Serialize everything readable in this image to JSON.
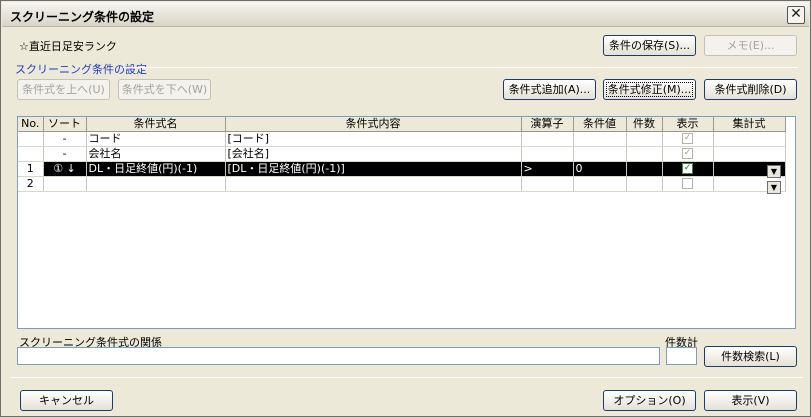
{
  "window": {
    "title": "スクリーニング条件の設定",
    "close_glyph": "✕"
  },
  "header": {
    "condition_name": "☆直近日足安ランク",
    "save_button": "条件の保存(S)...",
    "memo_button": "メモ(E)..."
  },
  "section_label": "スクリーニング条件の設定",
  "toolbar": {
    "move_up": "条件式を上へ(U)",
    "move_down": "条件式を下へ(W)",
    "add": "条件式追加(A)...",
    "modify": "条件式修正(M)...",
    "delete": "条件式削除(D)"
  },
  "grid": {
    "columns": [
      "No.",
      "ソート",
      "条件式名",
      "条件式内容",
      "演算子",
      "条件値",
      "件数",
      "表示",
      "集計式"
    ],
    "rows": [
      {
        "no": "",
        "sort": "-",
        "name": "コード",
        "content": "[コード]",
        "op": "",
        "value": "",
        "count": "",
        "show": "✓",
        "agg": ""
      },
      {
        "no": "",
        "sort": "-",
        "name": "会社名",
        "content": "[会社名]",
        "op": "",
        "value": "",
        "count": "",
        "show": "✓",
        "agg": ""
      },
      {
        "no": "1",
        "sort": "① ↓",
        "name": "DL・日足終値(円)(-1)",
        "content": "[DL・日足終値(円)(-1)]",
        "op": ">",
        "value": "0",
        "count": "",
        "show": "✓",
        "agg": ""
      },
      {
        "no": "2",
        "sort": "",
        "name": "",
        "content": "",
        "op": "",
        "value": "",
        "count": "",
        "show": "",
        "agg": ""
      }
    ],
    "dropdown_glyph": "▼"
  },
  "relation": {
    "label": "スクリーニング条件式の関係",
    "value": ""
  },
  "count_total": {
    "label": "件数計",
    "value": ""
  },
  "count_search_button": "件数検索(L)",
  "footer": {
    "cancel": "キャンセル",
    "option": "オプション(O)",
    "display": "表示(V)"
  }
}
